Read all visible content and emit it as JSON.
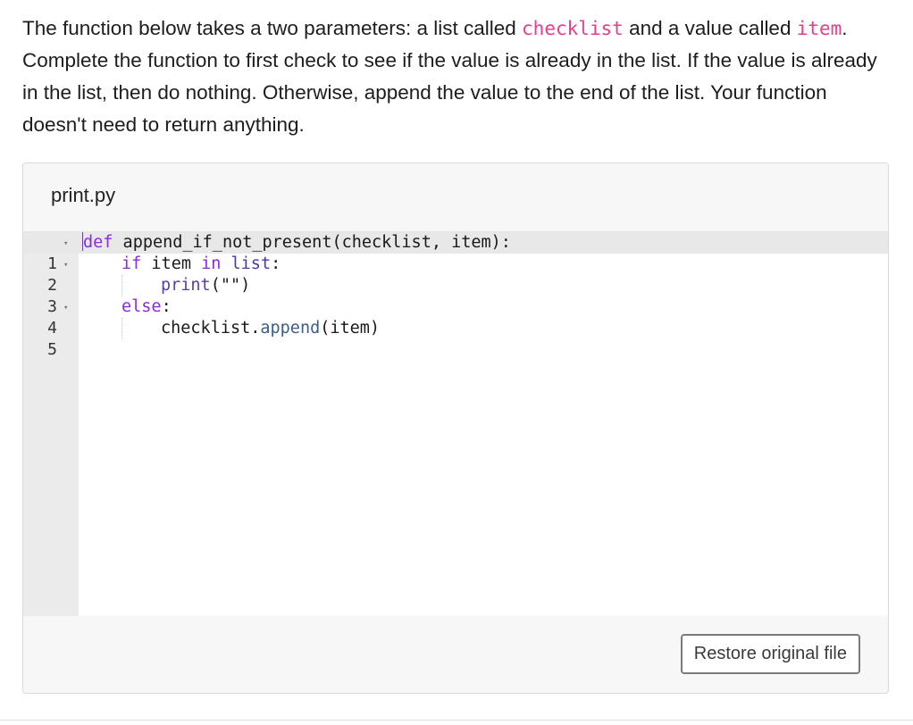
{
  "prompt": {
    "part1": "The function below takes a two parameters: a list called ",
    "code1": "checklist",
    "part2": " and a value called ",
    "code2": "item",
    "part3": ". Complete the function to first check to see if the value is already in the list. If the value is already in the list, then do nothing. Otherwise, append the value to the end of the list. Your function doesn't need to return anything."
  },
  "editor": {
    "filename": "print.py",
    "lines": [
      {
        "number": "1",
        "foldable": true
      },
      {
        "number": "2",
        "foldable": true
      },
      {
        "number": "3",
        "foldable": false
      },
      {
        "number": "4",
        "foldable": true
      },
      {
        "number": "5",
        "foldable": false
      }
    ],
    "tokens": {
      "def": "def",
      "func_sig": " append_if_not_present(checklist, item):",
      "if": "if",
      "if_rest_a": " item ",
      "in": "in",
      "space": " ",
      "list": "list",
      "colon": ":",
      "print": "print",
      "print_args": "(\"\")",
      "else": "else",
      "else_colon": ":",
      "checklist_obj": "checklist.",
      "append": "append",
      "append_args": "(item)"
    },
    "fold_glyph": "▾"
  },
  "footer": {
    "restore_label": "Restore original file"
  },
  "colors": {
    "inline_code": "#e83e8c",
    "keyword": "#8a2be2",
    "gutter_bg": "#ebebeb",
    "card_bg": "#f7f7f7"
  }
}
